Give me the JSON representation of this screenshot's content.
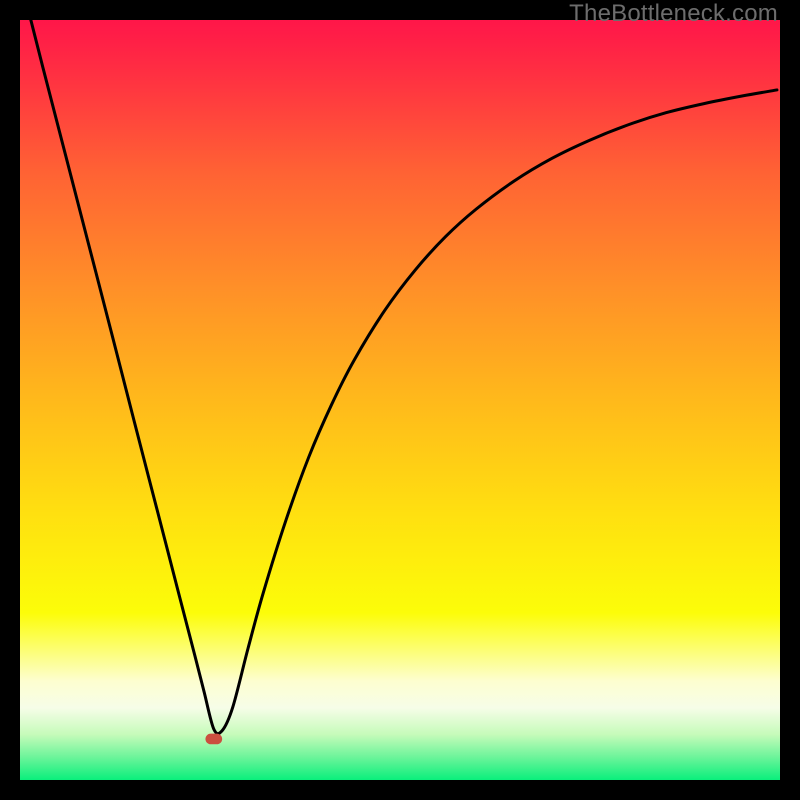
{
  "watermark": "TheBottleneck.com",
  "chart_data": {
    "type": "line",
    "title": "",
    "xlabel": "",
    "ylabel": "",
    "xlim": [
      0,
      100
    ],
    "ylim": [
      0,
      100
    ],
    "grid": false,
    "legend": false,
    "gradient": [
      {
        "t": 0.0,
        "color": "#ff1649"
      },
      {
        "t": 0.07,
        "color": "#ff2f42"
      },
      {
        "t": 0.2,
        "color": "#ff6234"
      },
      {
        "t": 0.35,
        "color": "#ff8f28"
      },
      {
        "t": 0.5,
        "color": "#ffb91b"
      },
      {
        "t": 0.65,
        "color": "#ffe010"
      },
      {
        "t": 0.78,
        "color": "#fcfd09"
      },
      {
        "t": 0.83,
        "color": "#fcfe76"
      },
      {
        "t": 0.87,
        "color": "#fdfed0"
      },
      {
        "t": 0.905,
        "color": "#f6fde8"
      },
      {
        "t": 0.94,
        "color": "#c6fbba"
      },
      {
        "t": 0.97,
        "color": "#6cf49a"
      },
      {
        "t": 1.0,
        "color": "#0aef7c"
      }
    ],
    "marker": {
      "shape": "rounded-rect",
      "x": 25.5,
      "y": 5.4,
      "width": 2.2,
      "height": 1.4,
      "fill": "#cb4f3f"
    },
    "series": [
      {
        "name": "curve",
        "x": [
          1.3,
          3,
          6,
          9,
          12,
          15,
          18,
          21,
          23,
          24.2,
          25.5,
          26.6,
          28,
          30,
          32,
          35,
          38,
          41,
          44,
          48,
          52,
          56,
          60,
          65,
          70,
          75,
          80,
          85,
          90,
          95,
          99.6
        ],
        "y": [
          100.5,
          93.8,
          82.2,
          70.6,
          59.0,
          47.3,
          35.7,
          24.1,
          16.4,
          11.7,
          6.7,
          6.5,
          9.6,
          17.3,
          24.6,
          34.2,
          42.5,
          49.4,
          55.3,
          61.8,
          67.1,
          71.5,
          75.1,
          78.8,
          81.8,
          84.2,
          86.2,
          87.8,
          89.0,
          90.0,
          90.8
        ]
      }
    ]
  }
}
